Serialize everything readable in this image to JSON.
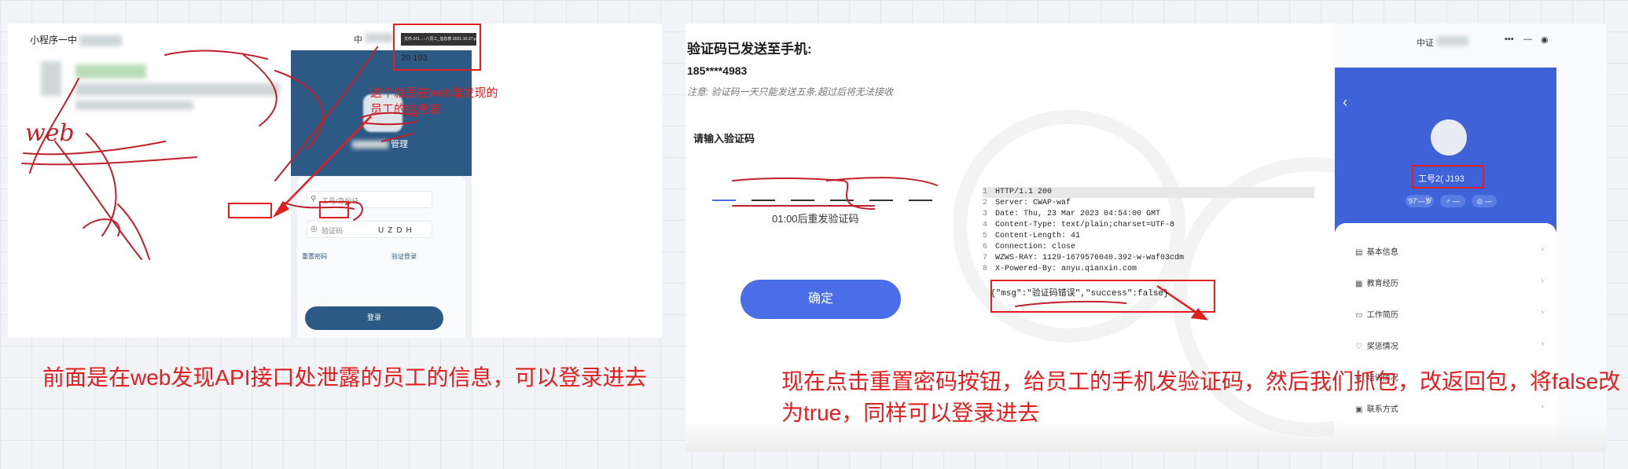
{
  "left": {
    "miniprogram_header": "小程序一中",
    "phone_title": "中",
    "phone_menu_icons": [
      "•••",
      "—",
      "◉"
    ],
    "banner_title": "管理",
    "username_placeholder": "工号/身份证",
    "code_placeholder": "验证码",
    "captcha_text": "UZDH",
    "reset_password": "重置密码",
    "sms_login": "验证登录",
    "login_button": "登录",
    "popup_file": "文件-201...--八员工_信息表-2021-10-27.pdf",
    "popup_value": "20 193",
    "annotation_note": "这个就是在web端发现的员工的信息表",
    "handwriting": "web"
  },
  "caption_left": "前面是在web发现API接口处泄露的员工的信息，可以登录进去",
  "right": {
    "sms_title": "验证码已发送至手机:",
    "sms_phone": "185****4983",
    "sms_note": "注意: 验证码一天只能发送五条,超过后将无法接收",
    "code_title": "请输入验证码",
    "countdown": "01:00后重发验证码",
    "confirm_button": "确定",
    "http_lines": [
      {
        "n": "1",
        "t": "HTTP/1.1 200"
      },
      {
        "n": "2",
        "t": "Server: CWAP-waf"
      },
      {
        "n": "3",
        "t": "Date: Thu, 23 Mar 2023 04:54:00 GMT"
      },
      {
        "n": "4",
        "t": "Content-Type: text/plain;charset=UTF-8"
      },
      {
        "n": "5",
        "t": "Content-Length: 41"
      },
      {
        "n": "6",
        "t": "Connection: close"
      },
      {
        "n": "7",
        "t": "WZWS-RAY: 1129-1679576040.392-w-waf03cdm"
      },
      {
        "n": "8",
        "t": "X-Powered-By: anyu.qianxin.com"
      }
    ],
    "response_body": "{\"msg\":\"验证码错误\",\"success\":false}",
    "profile": {
      "title": "中证",
      "icons": [
        "•••",
        "—",
        "◉"
      ],
      "staff_id": "工号2(    J193",
      "chips": [
        "'97'—岁",
        "♂ —",
        "◎ —"
      ],
      "menu": [
        {
          "icon": "▤",
          "label": "基本信息"
        },
        {
          "icon": "▦",
          "label": "教育经历"
        },
        {
          "icon": "▭",
          "label": "工作简历"
        },
        {
          "icon": "♡",
          "label": "奖惩情况"
        },
        {
          "icon": "◈",
          "label": "培训情况"
        },
        {
          "icon": "▣",
          "label": "联系方式"
        }
      ]
    }
  },
  "caption_right": "现在点击重置密码按钮，给员工的手机发验证码，然后我们抓包，改返回包，将false改为true，同样可以登录进去",
  "colors": {
    "annotation_red": "#e02020",
    "phone_blue": "#2d5985",
    "profile_blue": "#3f62d8",
    "button_blue": "#4a6ee8"
  }
}
